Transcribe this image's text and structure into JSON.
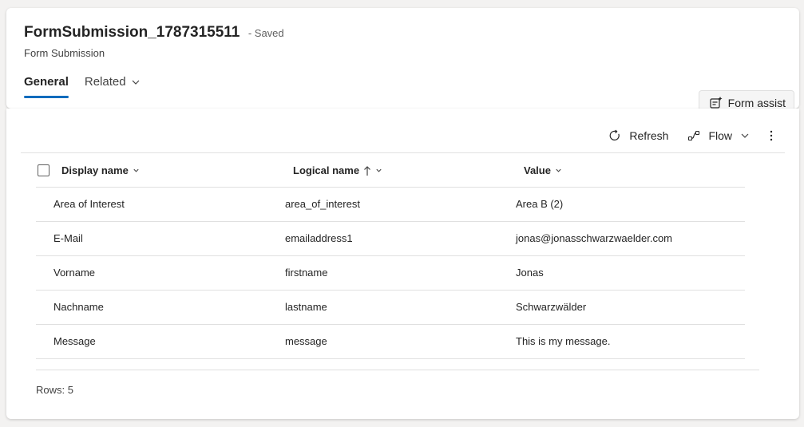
{
  "header": {
    "record_name": "FormSubmission_1787315511",
    "status": "- Saved",
    "entity_type": "Form Submission",
    "tabs": [
      {
        "label": "General",
        "active": true
      },
      {
        "label": "Related",
        "active": false
      }
    ],
    "form_assist_label": "Form assist"
  },
  "commandbar": {
    "refresh_label": "Refresh",
    "flow_label": "Flow"
  },
  "grid": {
    "columns": [
      {
        "label": "Display name",
        "icons": [
          "chevron-down-icon"
        ]
      },
      {
        "label": "Logical name",
        "icons": [
          "sort-ascending-icon",
          "chevron-down-icon"
        ]
      },
      {
        "label": "Value",
        "icons": [
          "chevron-down-icon"
        ]
      }
    ],
    "rows": [
      {
        "display_name": "Area of Interest",
        "logical_name": "area_of_interest",
        "value": "Area B (2)"
      },
      {
        "display_name": "E-Mail",
        "logical_name": "emailaddress1",
        "value": "jonas@jonasschwarzwaelder.com"
      },
      {
        "display_name": "Vorname",
        "logical_name": "firstname",
        "value": "Jonas"
      },
      {
        "display_name": "Nachname",
        "logical_name": "lastname",
        "value": "Schwarzwälder"
      },
      {
        "display_name": "Message",
        "logical_name": "message",
        "value": "This is my message."
      }
    ],
    "rows_count_label": "Rows: 5"
  },
  "colors": {
    "accent": "#0f6cbd",
    "background": "#f3f2f1",
    "card": "#ffffff",
    "divider": "#e0e0e0"
  }
}
